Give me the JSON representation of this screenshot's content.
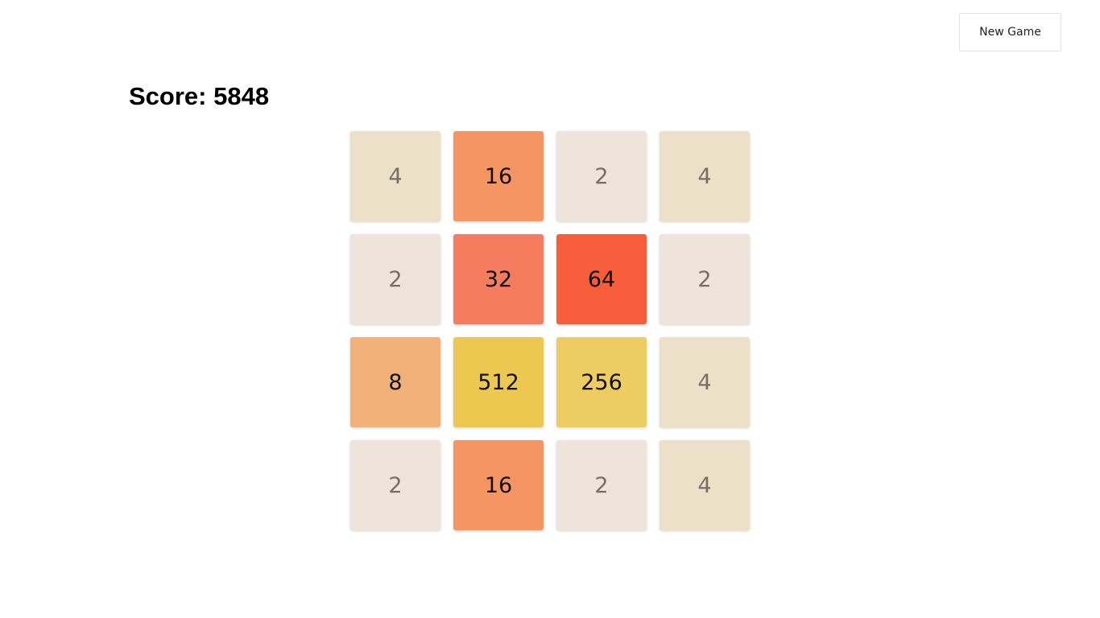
{
  "toolbar": {
    "new_game_label": "New Game"
  },
  "score": {
    "label": "Score: 5848"
  },
  "board": {
    "rows": [
      [
        "4",
        "16",
        "2",
        "4"
      ],
      [
        "2",
        "32",
        "64",
        "2"
      ],
      [
        "8",
        "512",
        "256",
        "4"
      ],
      [
        "2",
        "16",
        "2",
        "4"
      ]
    ]
  },
  "tile_colors": {
    "2": {
      "bg": "#eee4da",
      "fg": "#776e65"
    },
    "4": {
      "bg": "#ede0c8",
      "fg": "#776e65"
    },
    "8": {
      "bg": "#f2b179",
      "fg": "#111111"
    },
    "16": {
      "bg": "#f59563",
      "fg": "#111111"
    },
    "32": {
      "bg": "#f67c5f",
      "fg": "#111111"
    },
    "64": {
      "bg": "#f65e3b",
      "fg": "#111111"
    },
    "256": {
      "bg": "#edcc61",
      "fg": "#111111"
    },
    "512": {
      "bg": "#edc850",
      "fg": "#111111"
    }
  }
}
